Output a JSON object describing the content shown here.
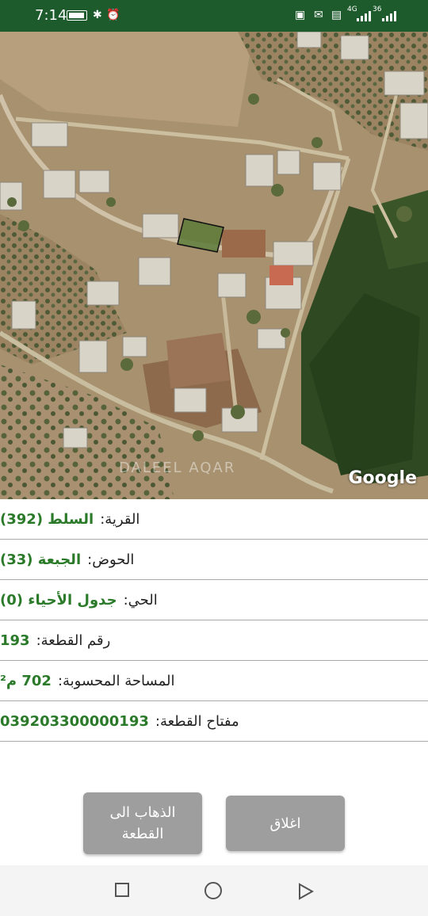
{
  "status_bar": {
    "time": "7:14",
    "network_label": "4G",
    "network_label_2": "36"
  },
  "map": {
    "provider_logo": "Google",
    "watermark": "DALEEL AQAR"
  },
  "parcel_info": [
    {
      "label": "القرية:",
      "value": "السلط (392)"
    },
    {
      "label": "الحوض:",
      "value": "الجبعة (33)"
    },
    {
      "label": "الحي:",
      "value": "جدول الأحياء (0)"
    },
    {
      "label": "رقم القطعة:",
      "value": "193"
    },
    {
      "label": "المساحة المحسوبة:",
      "value": "702 م²"
    },
    {
      "label": "مفتاح القطعة:",
      "value": "039203300000193"
    }
  ],
  "buttons": {
    "go_to_parcel": "الذهاب الى القطعة",
    "close": "اغلاق"
  },
  "colors": {
    "status_bar": "#1e5b2c",
    "value_text": "#2a7a2a",
    "button": "#9e9e9e"
  },
  "icons": {
    "nav": [
      "square-recents-icon",
      "circle-home-icon",
      "triangle-back-icon"
    ]
  }
}
